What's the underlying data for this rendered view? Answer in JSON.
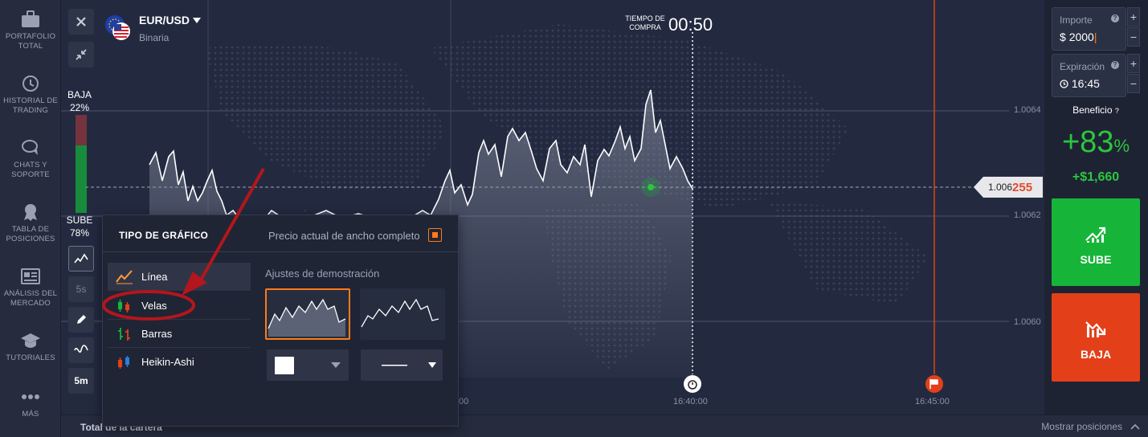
{
  "sidebar": {
    "items": [
      {
        "label": "PORTAFOLIO\nTOTAL",
        "icon": "briefcase-icon"
      },
      {
        "label": "HISTORIAL DE\nTRADING",
        "icon": "history-icon"
      },
      {
        "label": "CHATS Y\nSOPORTE",
        "icon": "chat-icon"
      },
      {
        "label": "TABLA DE\nPOSICIONES",
        "icon": "trophy-badge-icon"
      },
      {
        "label": "ANÁLISIS DEL\nMERCADO",
        "icon": "newspaper-icon"
      },
      {
        "label": "TUTORIALES",
        "icon": "graduation-cap-icon"
      },
      {
        "label": "MÁS",
        "icon": "more-dots-icon"
      }
    ]
  },
  "asset": {
    "name": "EUR/USD",
    "type": "Binaria"
  },
  "timer": {
    "label": "TIEMPO DE\nCOMPRA",
    "value": "00:50"
  },
  "sentiment": {
    "down_label": "BAJA",
    "down_pct": "22%",
    "up_label": "SUBE",
    "up_pct": "78%"
  },
  "tools": {
    "interval": "5s",
    "timeframe": "5m"
  },
  "price": {
    "prefix": "1.006",
    "highlight": "255"
  },
  "axis": {
    "y_ticks": [
      "1.0064",
      "1.0062",
      "1.0060"
    ],
    "x_ticks": [
      "00",
      "16:40:00",
      "16:45:00"
    ]
  },
  "right_panel": {
    "amount_label": "Importe",
    "amount_currency": "$",
    "amount_value": "2000",
    "expiry_label": "Expiración",
    "expiry_value": "16:45",
    "profit_label": "Beneficio",
    "profit_pct": "+83",
    "profit_pct_sign": "%",
    "profit_amount": "+$1,660",
    "up_button": "SUBE",
    "down_button": "BAJA",
    "plus": "+",
    "minus": "−"
  },
  "popup": {
    "title": "TIPO DE GRÁFICO",
    "full_width_label": "Precio actual de ancho completo",
    "demo_label": "Ajustes de demostración",
    "types": [
      {
        "label": "Línea",
        "selected": true
      },
      {
        "label": "Velas",
        "selected": false
      },
      {
        "label": "Barras",
        "selected": false
      },
      {
        "label": "Heikin-Ashi",
        "selected": false
      }
    ]
  },
  "bottom_bar": {
    "left": "Total de la cartera",
    "right": "Mostrar posiciones"
  },
  "colors": {
    "up": "#16b53a",
    "down": "#e3401a",
    "accent": "#ff7a1a",
    "profit": "#2cc63d"
  }
}
